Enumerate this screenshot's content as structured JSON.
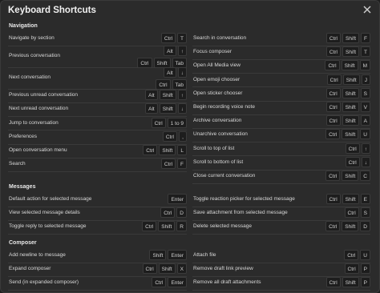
{
  "title": "Keyboard Shortcuts",
  "sections": [
    {
      "title": "Navigation",
      "left": [
        {
          "label": "Navigate by section",
          "combos": [
            [
              "Ctrl",
              "T"
            ]
          ]
        },
        {
          "label": "Previous conversation",
          "combos": [
            [
              "Alt",
              "↑"
            ],
            [
              "Ctrl",
              "Shift",
              "Tab"
            ]
          ]
        },
        {
          "label": "Next conversation",
          "combos": [
            [
              "Alt",
              "↓"
            ],
            [
              "Ctrl",
              "Tab"
            ]
          ]
        },
        {
          "label": "Previous unread conversation",
          "combos": [
            [
              "Alt",
              "Shift",
              "↑"
            ]
          ]
        },
        {
          "label": "Next unread conversation",
          "combos": [
            [
              "Alt",
              "Shift",
              "↓"
            ]
          ]
        },
        {
          "label": "Jump to conversation",
          "combos": [
            [
              "Ctrl",
              "1 to 9"
            ]
          ]
        },
        {
          "label": "Preferences",
          "combos": [
            [
              "Ctrl",
              ","
            ]
          ]
        },
        {
          "label": "Open conversation menu",
          "combos": [
            [
              "Ctrl",
              "Shift",
              "L"
            ]
          ]
        },
        {
          "label": "Search",
          "combos": [
            [
              "Ctrl",
              "F"
            ]
          ]
        }
      ],
      "right": [
        {
          "label": "Search in conversation",
          "combos": [
            [
              "Ctrl",
              "Shift",
              "F"
            ]
          ]
        },
        {
          "label": "Focus composer",
          "combos": [
            [
              "Ctrl",
              "Shift",
              "T"
            ]
          ]
        },
        {
          "label": "Open All Media view",
          "combos": [
            [
              "Ctrl",
              "Shift",
              "M"
            ]
          ]
        },
        {
          "label": "Open emoji chooser",
          "combos": [
            [
              "Ctrl",
              "Shift",
              "J"
            ]
          ]
        },
        {
          "label": "Open sticker chooser",
          "combos": [
            [
              "Ctrl",
              "Shift",
              "S"
            ]
          ]
        },
        {
          "label": "Begin recording voice note",
          "combos": [
            [
              "Ctrl",
              "Shift",
              "V"
            ]
          ]
        },
        {
          "label": "Archive conversation",
          "combos": [
            [
              "Ctrl",
              "Shift",
              "A"
            ]
          ]
        },
        {
          "label": "Unarchive conversation",
          "combos": [
            [
              "Ctrl",
              "Shift",
              "U"
            ]
          ]
        },
        {
          "label": "Scroll to top of list",
          "combos": [
            [
              "Ctrl",
              "↑"
            ]
          ]
        },
        {
          "label": "Scroll to bottom of list",
          "combos": [
            [
              "Ctrl",
              "↓"
            ]
          ]
        },
        {
          "label": "Close current conversation",
          "combos": [
            [
              "Ctrl",
              "Shift",
              "C"
            ]
          ]
        }
      ]
    },
    {
      "title": "Messages",
      "left": [
        {
          "label": "Default action for selected message",
          "combos": [
            [
              "Enter"
            ]
          ]
        },
        {
          "label": "View selected message details",
          "combos": [
            [
              "Ctrl",
              "D"
            ]
          ]
        },
        {
          "label": "Toggle reply to selected message",
          "combos": [
            [
              "Ctrl",
              "Shift",
              "R"
            ]
          ]
        }
      ],
      "right": [
        {
          "label": "Toggle reaction picker for selected message",
          "combos": [
            [
              "Ctrl",
              "Shift",
              "E"
            ]
          ]
        },
        {
          "label": "Save attachment from selected message",
          "combos": [
            [
              "Ctrl",
              "S"
            ]
          ]
        },
        {
          "label": "Delete selected message",
          "combos": [
            [
              "Ctrl",
              "Shift",
              "D"
            ]
          ]
        }
      ]
    },
    {
      "title": "Composer",
      "left": [
        {
          "label": "Add newline to message",
          "combos": [
            [
              "Shift",
              "Enter"
            ]
          ]
        },
        {
          "label": "Expand composer",
          "combos": [
            [
              "Ctrl",
              "Shift",
              "X"
            ]
          ]
        },
        {
          "label": "Send (in expanded composer)",
          "combos": [
            [
              "Ctrl",
              "Enter"
            ]
          ]
        }
      ],
      "right": [
        {
          "label": "Attach file",
          "combos": [
            [
              "Ctrl",
              "U"
            ]
          ]
        },
        {
          "label": "Remove draft link preview",
          "combos": [
            [
              "Ctrl",
              "P"
            ]
          ]
        },
        {
          "label": "Remove all draft attachments",
          "combos": [
            [
              "Ctrl",
              "Shift",
              "P"
            ]
          ]
        }
      ]
    }
  ]
}
